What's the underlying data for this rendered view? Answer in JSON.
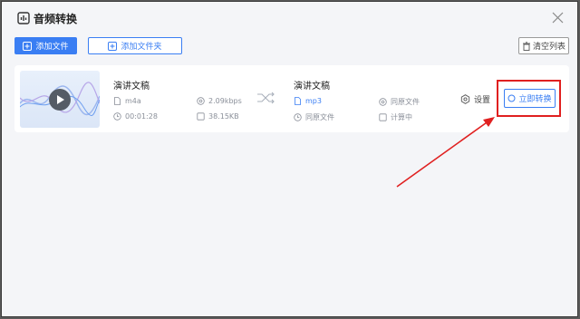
{
  "window": {
    "title": "音频转换"
  },
  "toolbar": {
    "add_file": "添加文件",
    "add_folder": "添加文件夹",
    "clear_list": "清空列表"
  },
  "file": {
    "source": {
      "name": "演讲文稿",
      "format": "m4a",
      "duration": "00:01:28",
      "bitrate": "2.09kbps",
      "size": "38.15KB"
    },
    "target": {
      "name": "演讲文稿",
      "format": "mp3",
      "quality": "同原文件",
      "duration": "同原文件",
      "size": "计算中"
    },
    "settings_label": "设置",
    "convert_button": "立即转换"
  },
  "colors": {
    "accent": "#3a7ef3",
    "annotation": "#e02020"
  }
}
